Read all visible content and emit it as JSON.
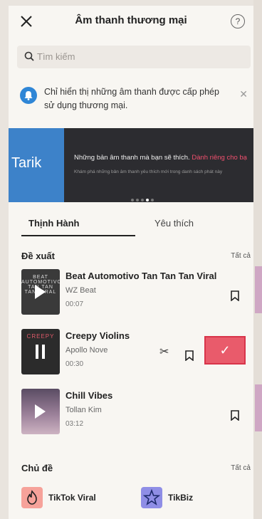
{
  "header": {
    "title": "Âm thanh thương mại",
    "close_icon": "close-icon",
    "help_icon": "help-icon"
  },
  "search": {
    "placeholder": "Tìm kiếm"
  },
  "notice": {
    "text": "Chỉ hiển thị những âm thanh được cấp phép sử dụng thương mại.",
    "icon": "bell-icon"
  },
  "banner": {
    "left_text": "Tarik",
    "line1": "Những bản âm thanh mà bạn sẽ thích.",
    "line1_accent": "Dành riêng cho bạ",
    "line2": "Khám phá những bản âm thanh yêu thích mới trong danh sách phát này",
    "slide_count": 5,
    "active_slide": 4
  },
  "tabs": [
    {
      "label": "Thịnh Hành",
      "active": true
    },
    {
      "label": "Yêu thích",
      "active": false
    }
  ],
  "suggested": {
    "heading": "Đề xuất",
    "see_all": "Tất cả",
    "tracks": [
      {
        "title": "Beat Automotivo Tan Tan Tan Viral",
        "artist": "WZ Beat",
        "duration": "00:07",
        "cover_text": "BEAT AUTOMOTIVO TAN TAN TAN VIRAL",
        "state": "paused"
      },
      {
        "title": "Creepy Violins",
        "artist": "Apollo Nove",
        "duration": "00:30",
        "cover_text": "CREEPY",
        "state": "playing"
      },
      {
        "title": "Chill Vibes",
        "artist": "Tollan Kim",
        "duration": "03:12",
        "cover_text": "",
        "state": "paused"
      }
    ],
    "use_button_symbol": "✓",
    "cut_symbol": "✂"
  },
  "topics": {
    "heading": "Chủ đề",
    "see_all": "Tất cả",
    "items": [
      {
        "label": "TikTok Viral",
        "icon": "flame-icon",
        "color": "#f6a29a"
      },
      {
        "label": "TikBiz",
        "icon": "star-icon",
        "color": "#8f8ee6"
      }
    ]
  },
  "colors": {
    "accent": "#e95b6b",
    "banner_blue": "#3d82c9",
    "banner_dark": "#2c2c30",
    "bell_blue": "#2f86d6"
  }
}
